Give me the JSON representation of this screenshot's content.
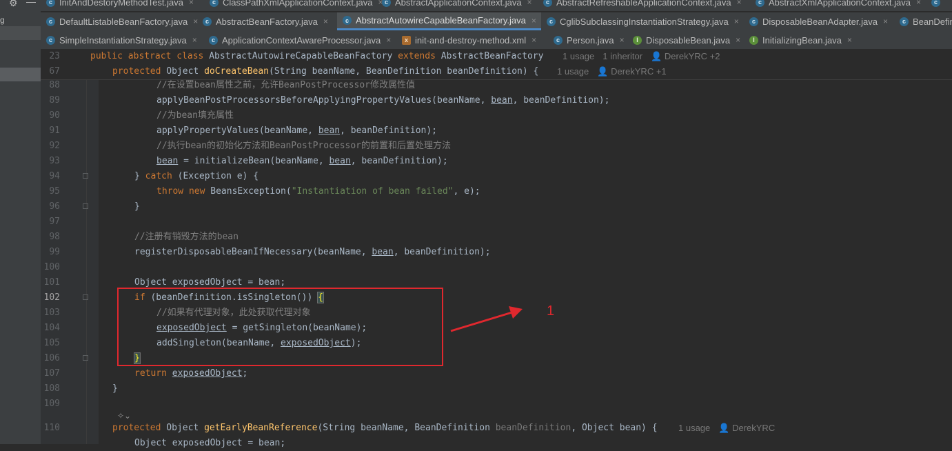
{
  "left_panel": {
    "fragment": "g"
  },
  "tabs_row1": [
    {
      "label": "InitAndDestoryMethodTest.java",
      "icon": "c"
    },
    {
      "label": "ClassPathXmlApplicationContext.java",
      "icon": "c"
    },
    {
      "label": "AbstractApplicationContext.java",
      "icon": "c"
    },
    {
      "label": "AbstractRefreshableApplicationContext.java",
      "icon": "c"
    },
    {
      "label": "AbstractXmlApplicationContext.java",
      "icon": "c"
    }
  ],
  "tabs_row2": [
    {
      "label": "DefaultListableBeanFactory.java",
      "icon": "c"
    },
    {
      "label": "AbstractBeanFactory.java",
      "icon": "c"
    },
    {
      "label": "AbstractAutowireCapableBeanFactory.java",
      "icon": "c",
      "active": true
    },
    {
      "label": "CglibSubclassingInstantiationStrategy.java",
      "icon": "c"
    },
    {
      "label": "DisposableBeanAdapter.java",
      "icon": "c"
    },
    {
      "label": "BeanDefin",
      "icon": "c"
    }
  ],
  "tabs_row3": [
    {
      "label": "SimpleInstantiationStrategy.java",
      "icon": "c"
    },
    {
      "label": "ApplicationContextAwareProcessor.java",
      "icon": "c"
    },
    {
      "label": "init-and-destroy-method.xml",
      "icon": "x"
    },
    {
      "label": "Person.java",
      "icon": "c"
    },
    {
      "label": "DisposableBean.java",
      "icon": "i"
    },
    {
      "label": "InitializingBean.java",
      "icon": "i"
    }
  ],
  "sticky": {
    "l23": {
      "num": "23",
      "pre": "public abstract class ",
      "cls": "AbstractAutowireCapableBeanFactory ",
      "ext": "extends ",
      "parent": "AbstractBeanFactory",
      "usage": "1 usage",
      "inheritor": "1 inheritor",
      "author": "DerekYRC +2"
    },
    "l67": {
      "num": "67",
      "mod": "protected ",
      "type": "Object ",
      "name": "doCreateBean",
      "params": "(String beanName, BeanDefinition beanDefinition) {",
      "usage": "1 usage",
      "author": "DerekYRC +1"
    }
  },
  "lines": {
    "n88": "88",
    "c88": "//在设置bean属性之前，允许BeanPostProcessor修改属性值",
    "n89": "89",
    "f89": "applyBeanPostProcessorsBeforeApplyingPropertyValues",
    "a89": "(beanName, ",
    "b89": "bean",
    "z89": ", beanDefinition);",
    "n90": "90",
    "c90": "//为bean填充属性",
    "n91": "91",
    "f91": "applyPropertyValues",
    "a91": "(beanName, ",
    "b91": "bean",
    "z91": ", beanDefinition);",
    "n92": "92",
    "c92": "//执行bean的初始化方法和BeanPostProcessor的前置和后置处理方法",
    "n93": "93",
    "v93": "bean",
    "e93": " = ",
    "f93": "initializeBean",
    "a93": "(beanName, ",
    "b93": "bean",
    "z93": ", beanDefinition);",
    "n94": "94",
    "p94": "} ",
    "k94": "catch ",
    "z94": "(Exception e) {",
    "n95": "95",
    "k95a": "throw ",
    "k95b": "new ",
    "t95": "BeansException(",
    "s95": "\"Instantiation of bean failed\"",
    "z95": ", e);",
    "n96": "96",
    "z96": "}",
    "n97": "97",
    "n98": "98",
    "c98": "//注册有销毁方法的bean",
    "n99": "99",
    "f99": "registerDisposableBeanIfNecessary",
    "a99": "(beanName, ",
    "b99": "bean",
    "z99": ", beanDefinition);",
    "n100": "100",
    "n101": "101",
    "z101": "Object exposedObject = bean;",
    "n102": "102",
    "k102": "if ",
    "z102": "(beanDefinition.isSingleton()) ",
    "br102": "{",
    "n103": "103",
    "c103": "//如果有代理对象，此处获取代理对象",
    "n104": "104",
    "v104": "exposedObject",
    "e104": " = ",
    "f104": "getSingleton",
    "z104": "(beanName);",
    "n105": "105",
    "f105": "addSingleton",
    "a105": "(beanName, ",
    "v105": "exposedObject",
    "z105": ");",
    "n106": "106",
    "br106": "}",
    "n107": "107",
    "k107": "return ",
    "v107": "exposedObject",
    "z107": ";",
    "n108": "108",
    "z108": "}",
    "n109": "109",
    "n110": "110",
    "k110": "protected ",
    "t110": "Object ",
    "f110": "getEarlyBeanReference",
    "a110": "(String beanName, BeanDefinition ",
    "g110": "beanDefinition",
    "z110": ", Object bean) {",
    "usage110": "1 usage",
    "author110": "DerekYRC",
    "z111": "Object exposedObject = bean;"
  },
  "annotation": {
    "label": "1",
    "color": "#e0282e"
  }
}
